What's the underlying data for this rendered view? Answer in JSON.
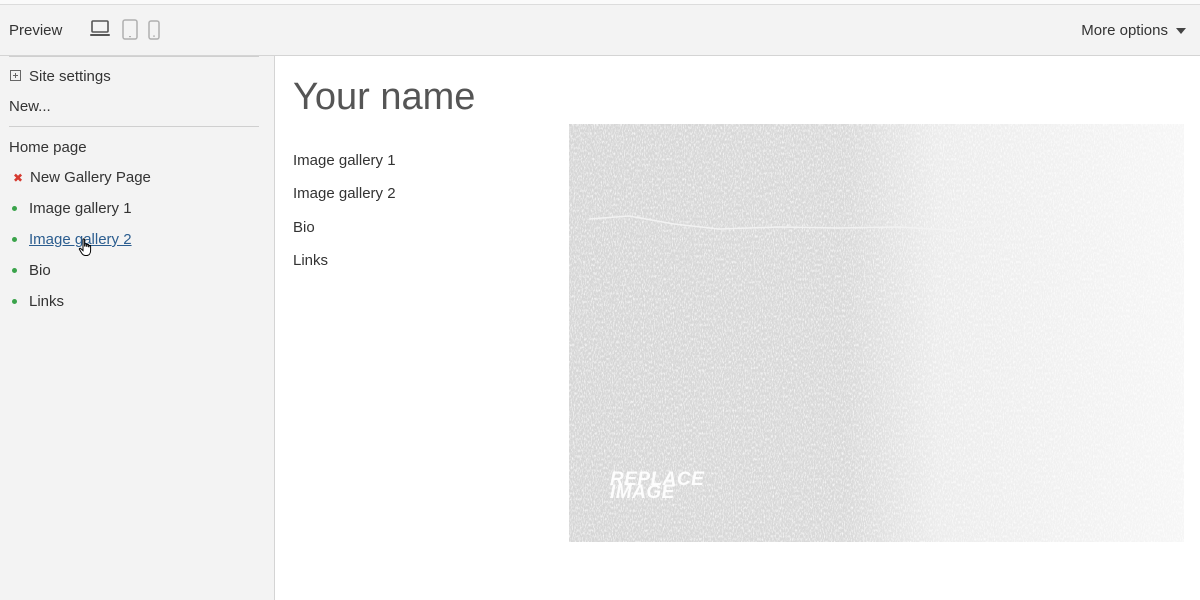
{
  "toolbar": {
    "preview_label": "Preview",
    "devices": [
      {
        "name": "laptop-icon",
        "active": true
      },
      {
        "name": "tablet-icon",
        "active": false
      },
      {
        "name": "phone-icon",
        "active": false
      }
    ],
    "more_options_label": "More options"
  },
  "sidebar": {
    "site_settings_label": "Site settings",
    "new_label": "New...",
    "home_page_label": "Home page",
    "pages": [
      {
        "label": "New Gallery Page",
        "status": "error"
      },
      {
        "label": "Image gallery 1",
        "status": "published"
      },
      {
        "label": "Image gallery 2",
        "status": "published",
        "hovered": true
      },
      {
        "label": "Bio",
        "status": "published"
      },
      {
        "label": "Links",
        "status": "published"
      }
    ],
    "colors": {
      "published_dot": "#3aa34a",
      "error_mark": "#d63a2f",
      "link": "#2b5d8f"
    }
  },
  "site": {
    "title": "Your name",
    "nav": [
      "Image gallery 1",
      "Image gallery 2",
      "Bio",
      "Links"
    ],
    "hero_placeholder": {
      "line1": "REPLACE",
      "line2": "IMAGE"
    }
  }
}
